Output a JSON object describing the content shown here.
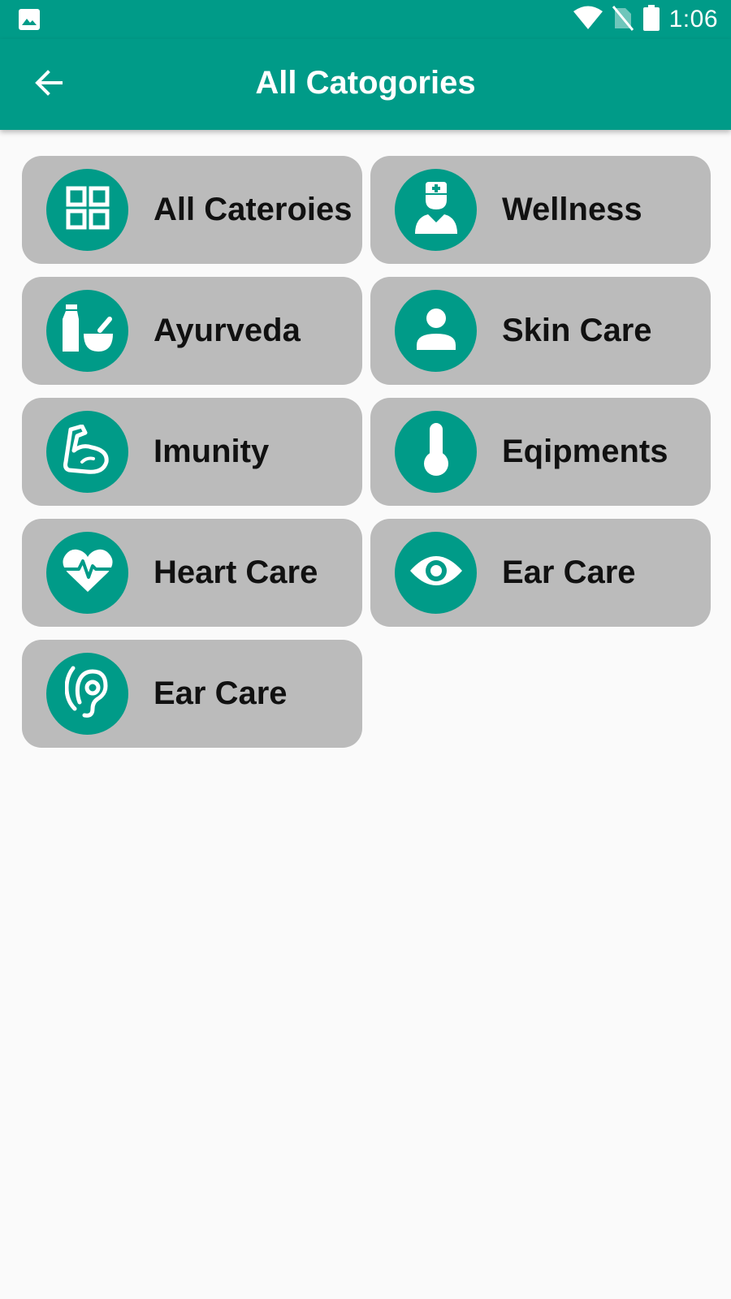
{
  "status_bar": {
    "time": "1:06",
    "icons": [
      "image-icon",
      "wifi-icon",
      "no-sim-icon",
      "battery-icon"
    ]
  },
  "app_bar": {
    "title": "All Catogories",
    "back_icon": "arrow-back-icon"
  },
  "colors": {
    "primary": "#009b88",
    "card_bg": "#bbbbbb",
    "page_bg": "#fafafa"
  },
  "categories": [
    {
      "label": "All Cateroies",
      "icon": "grid-icon"
    },
    {
      "label": "Wellness",
      "icon": "doctor-icon"
    },
    {
      "label": "Ayurveda",
      "icon": "mortar-pestle-icon"
    },
    {
      "label": "Skin Care",
      "icon": "person-icon"
    },
    {
      "label": "Imunity",
      "icon": "flexed-arm-icon"
    },
    {
      "label": "Eqipments",
      "icon": "thermometer-icon"
    },
    {
      "label": "Heart Care",
      "icon": "heart-pulse-icon"
    },
    {
      "label": "Ear Care",
      "icon": "eye-icon"
    },
    {
      "label": "Ear Care",
      "icon": "ear-icon"
    }
  ]
}
